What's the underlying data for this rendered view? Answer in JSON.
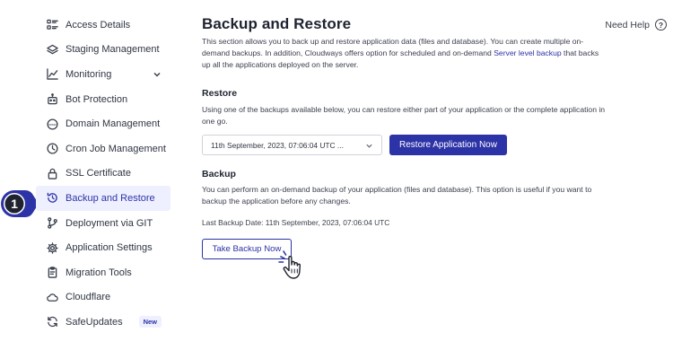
{
  "sidebar": {
    "items": [
      {
        "label": "Access Details",
        "icon": "list-icon"
      },
      {
        "label": "Staging Management",
        "icon": "layers-icon"
      },
      {
        "label": "Monitoring",
        "icon": "chart-icon",
        "has_chevron": true
      },
      {
        "label": "Bot Protection",
        "icon": "robot-icon"
      },
      {
        "label": "Domain Management",
        "icon": "www-icon"
      },
      {
        "label": "Cron Job Management",
        "icon": "clock-icon"
      },
      {
        "label": "SSL Certificate",
        "icon": "lock-icon"
      },
      {
        "label": "Backup and Restore",
        "icon": "history-icon",
        "active": true
      },
      {
        "label": "Deployment via GIT",
        "icon": "git-icon"
      },
      {
        "label": "Application Settings",
        "icon": "gear-icon"
      },
      {
        "label": "Migration Tools",
        "icon": "clipboard-icon"
      },
      {
        "label": "Cloudflare",
        "icon": "cloud-icon"
      },
      {
        "label": "SafeUpdates",
        "icon": "refresh-icon",
        "badge": "New"
      }
    ]
  },
  "step_marker": {
    "number": "1",
    "color": "#2c33a6"
  },
  "header": {
    "title": "Backup and Restore",
    "help_label": "Need Help",
    "help_icon": "question-circle-icon"
  },
  "intro": {
    "text_before": "This section allows you to back up and restore application data (files and database). You can create multiple on-demand backups. In addition, Cloudways offers option for scheduled and on-demand ",
    "link_text": "Server level backup",
    "text_after": " that backs up all the applications deployed on the server."
  },
  "restore": {
    "title": "Restore",
    "description": "Using one of the backups available below, you can restore either part of your application or the complete application in one go.",
    "select_value": "11th September, 2023, 07:06:04 UTC ...",
    "button_label": "Restore Application Now"
  },
  "backup": {
    "title": "Backup",
    "description": "You can perform an on-demand backup of your application (files and database). This option is useful if you want to backup the application before any changes.",
    "last_backup": "Last Backup Date: 11th September, 2023, 07:06:04 UTC",
    "button_label": "Take Backup Now"
  },
  "colors": {
    "accent": "#2c33a6",
    "active_bg": "#eef0ff",
    "text": "#2f3542"
  }
}
